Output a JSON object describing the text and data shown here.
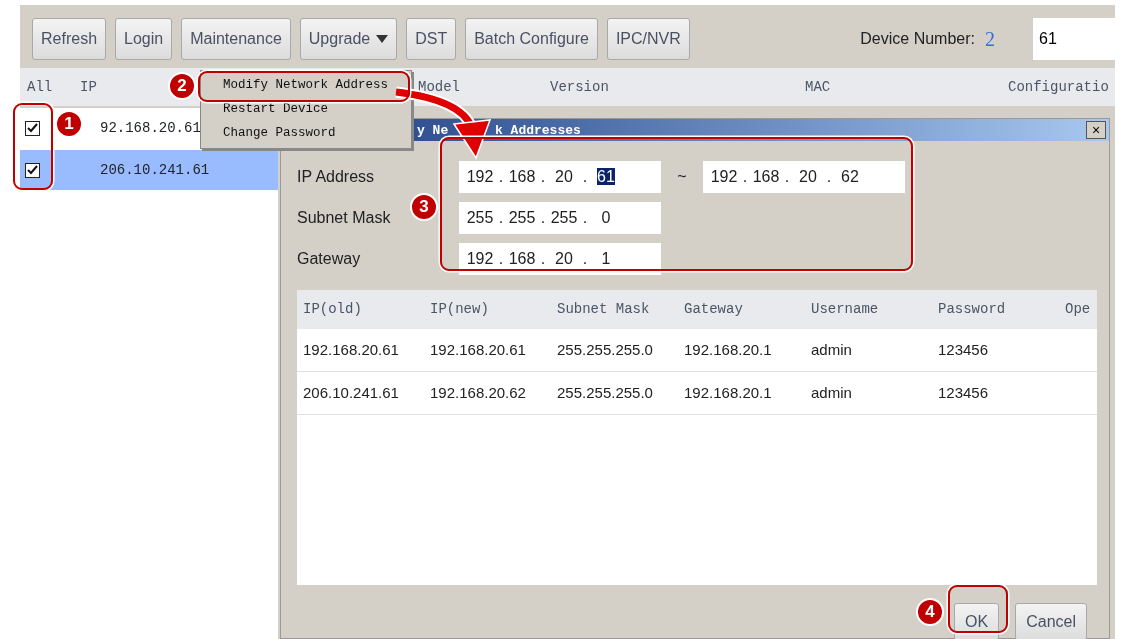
{
  "toolbar": {
    "buttons": [
      {
        "label": "Refresh",
        "kind": "plain"
      },
      {
        "label": "Login",
        "kind": "plain"
      },
      {
        "label": "Maintenance",
        "kind": "plain"
      },
      {
        "label": "Upgrade",
        "kind": "dropdown"
      },
      {
        "label": "DST",
        "kind": "plain"
      },
      {
        "label": "Batch Configure",
        "kind": "plain"
      },
      {
        "label": "IPC/NVR",
        "kind": "plain"
      }
    ],
    "device_number_label": "Device Number:",
    "device_number": "2",
    "search_value": "61"
  },
  "device_list": {
    "columns": [
      "All",
      "IP",
      "Model",
      "Version",
      "MAC",
      "Configuratio"
    ],
    "rows": [
      {
        "ip": "92.168.20.61",
        "checked": true,
        "selected": false
      },
      {
        "ip": "206.10.241.61",
        "checked": true,
        "selected": true
      }
    ]
  },
  "context_menu": {
    "items": [
      {
        "label": "Modify Network Address"
      },
      {
        "label": "Restart Device"
      },
      {
        "label": "Change Password"
      }
    ]
  },
  "dialog": {
    "title_fragments": [
      "y Ne",
      "k Addresses"
    ],
    "close_glyph": "×",
    "fields": [
      {
        "label": "IP Address",
        "separator": ".",
        "octets": [
          {
            "value": "192",
            "selected": false
          },
          {
            "value": "168",
            "selected": false
          },
          {
            "value": "20",
            "selected": false
          },
          {
            "value": "61",
            "selected": true
          }
        ],
        "range_separator": "~",
        "range_to": [
          {
            "value": "192",
            "selected": false
          },
          {
            "value": "168",
            "selected": false
          },
          {
            "value": "20",
            "selected": false
          },
          {
            "value": "62",
            "selected": false
          }
        ]
      },
      {
        "label": "Subnet Mask",
        "separator": ".",
        "octets": [
          {
            "value": "255",
            "selected": false
          },
          {
            "value": "255",
            "selected": false
          },
          {
            "value": "255",
            "selected": false
          },
          {
            "value": "0",
            "selected": false
          }
        ]
      },
      {
        "label": "Gateway",
        "separator": ".",
        "octets": [
          {
            "value": "192",
            "selected": false
          },
          {
            "value": "168",
            "selected": false
          },
          {
            "value": "20",
            "selected": false
          },
          {
            "value": "1",
            "selected": false
          }
        ]
      }
    ],
    "table": {
      "columns": [
        "IP(old)",
        "IP(new)",
        "Subnet Mask",
        "Gateway",
        "Username",
        "Password",
        "Ope"
      ],
      "rows": [
        [
          "192.168.20.61",
          "192.168.20.61",
          "255.255.255.0",
          "192.168.20.1",
          "admin",
          "123456"
        ],
        [
          "206.10.241.61",
          "192.168.20.62",
          "255.255.255.0",
          "192.168.20.1",
          "admin",
          "123456"
        ]
      ]
    },
    "buttons": [
      "OK",
      "Cancel"
    ]
  },
  "callouts": [
    {
      "label": "1"
    },
    {
      "label": "2"
    },
    {
      "label": "3"
    },
    {
      "label": "4"
    }
  ]
}
